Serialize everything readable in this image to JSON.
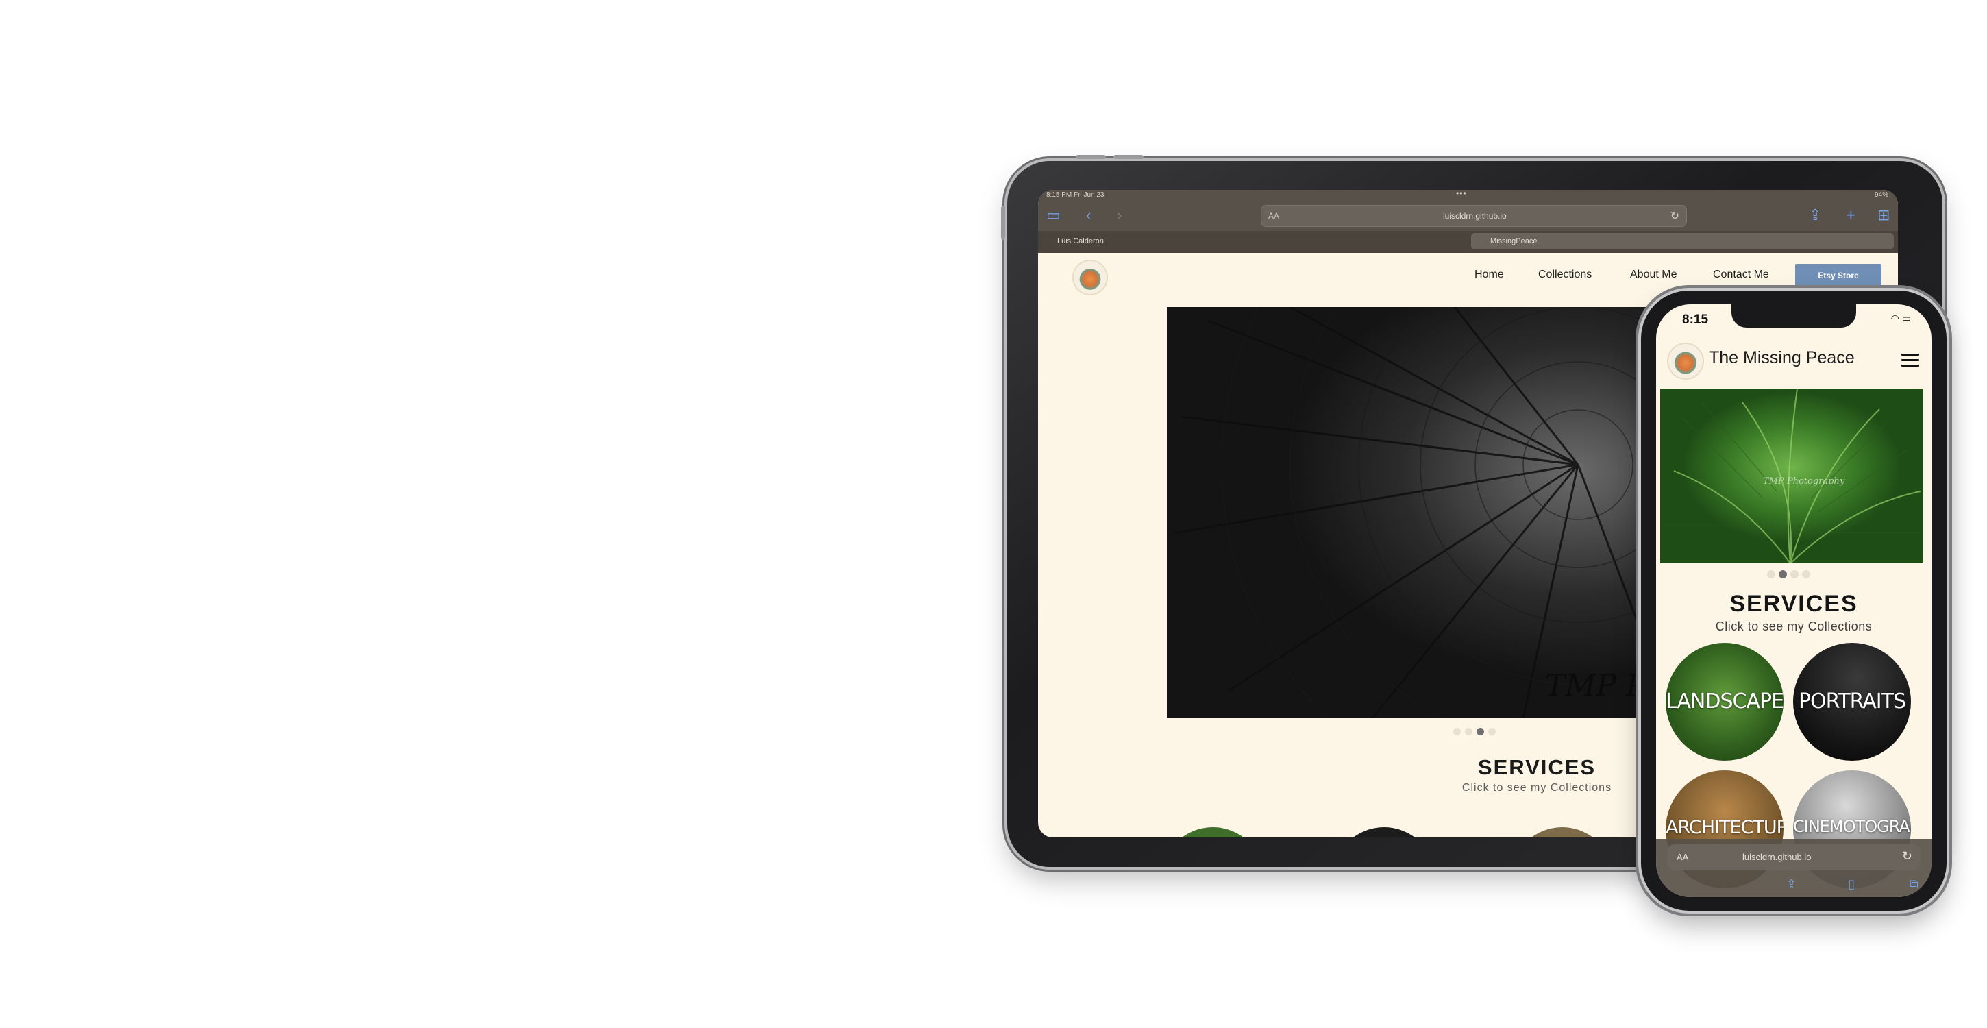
{
  "tablet": {
    "status": {
      "time": "8:15 PM  Fri Jun 23",
      "dots": "•••",
      "battery": "94%"
    },
    "browser": {
      "address_prefix": "AA",
      "url": "luiscldrn.github.io",
      "tabs": [
        {
          "label": "Luis Calderon"
        },
        {
          "label": "MissingPeace"
        }
      ]
    },
    "nav": {
      "home": "Home",
      "collections": "Collections",
      "about": "About Me",
      "contact": "Contact Me",
      "etsy": "Etsy Store"
    },
    "hero": {
      "watermark": "TMP Phi"
    },
    "services": {
      "title": "SERVICES",
      "subtitle": "Click to see my Collections"
    }
  },
  "phone": {
    "status": {
      "time": "8:15"
    },
    "title": "The Missing Peace",
    "services": {
      "title": "SERVICES",
      "subtitle": "Click to see my Collections"
    },
    "collections": [
      {
        "label": "LANDSCAPE"
      },
      {
        "label": "PORTRAITS"
      },
      {
        "label": "ARCHITECTURE"
      },
      {
        "label": "CINEMOTOGRAPHY"
      }
    ],
    "browser": {
      "address_prefix": "AA",
      "url": "luiscldrn.github.io"
    }
  }
}
